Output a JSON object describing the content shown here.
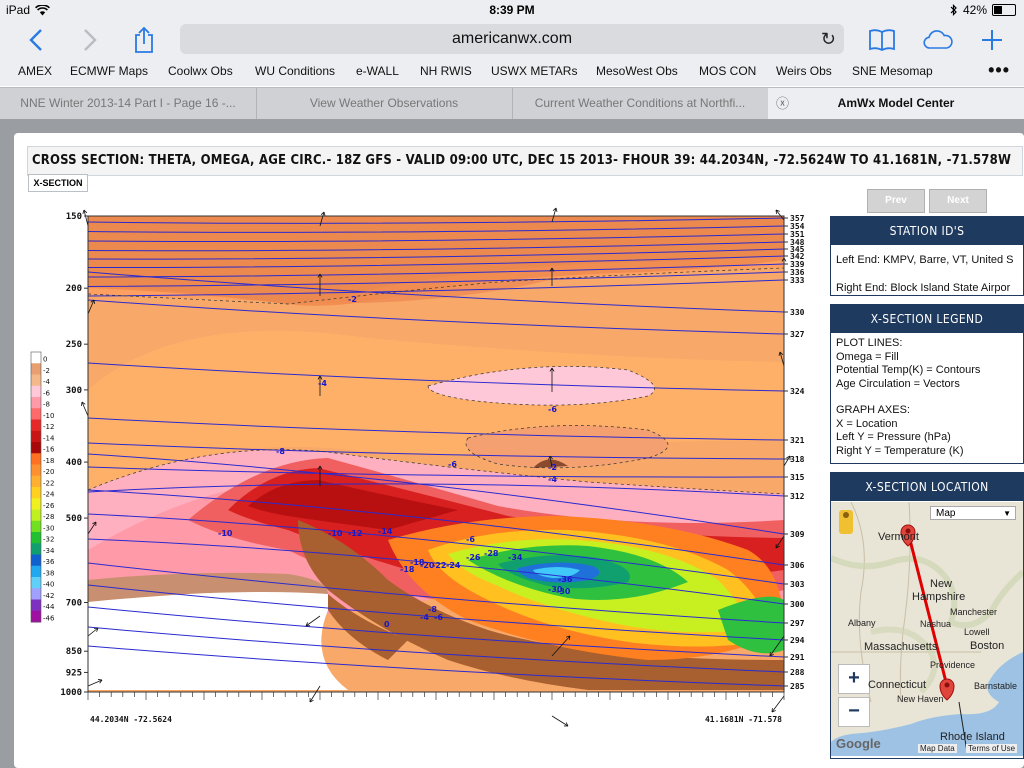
{
  "status": {
    "device": "iPad",
    "time": "8:39 PM",
    "battery": "42%",
    "battery_fraction": 0.42
  },
  "toolbar": {
    "url": "americanwx.com",
    "back": "back-chevron-icon",
    "forward": "forward-chevron-icon",
    "share": "share-icon",
    "bookmarks": "book-icon",
    "cloud": "cloud-icon",
    "add": "plus-icon",
    "reload": "reload-icon"
  },
  "bookmarks": [
    "AMEX",
    "ECMWF Maps",
    "Coolwx Obs",
    "WU Conditions",
    "e-WALL",
    "NH RWIS",
    "USWX METARs",
    "MesoWest Obs",
    "MOS CON",
    "Weirs Obs",
    "SNE Mesomap"
  ],
  "tabs": [
    {
      "label": "NNE Winter 2013-14 Part I - Page 16 -...",
      "active": false
    },
    {
      "label": "View Weather Observations",
      "active": false
    },
    {
      "label": "Current Weather Conditions at Northfi...",
      "active": false
    },
    {
      "label": "AmWx Model Center",
      "active": true
    }
  ],
  "page": {
    "title": "CROSS SECTION: THETA, OMEGA, AGE CIRC.- 18Z GFS - VALID 09:00 UTC, DEC 15 2013- FHOUR 39: 44.2034N, -72.5624W TO 41.1681N, -71.578W",
    "xsec_tab": "X-SECTION",
    "prev": "Prev",
    "next": "Next"
  },
  "station": {
    "header": "STATION ID'S",
    "left": "Left End: KMPV, Barre, VT, United S",
    "right": "Right End: Block Island State Airpor"
  },
  "legend": {
    "header": "X-SECTION LEGEND",
    "lines": [
      "PLOT LINES:",
      "Omega = Fill",
      "Potential Temp(K) = Contours",
      "Age Circulation = Vectors",
      "",
      "GRAPH AXES:",
      "X = Location",
      "Left Y = Pressure (hPa)",
      "Right Y = Temperature (K)"
    ]
  },
  "location": {
    "header": "X-SECTION LOCATION",
    "map_type": "Map",
    "zoom_in": "+",
    "zoom_out": "−",
    "labels": [
      "Vermont",
      "New Hampshire",
      "Manchester",
      "Nashua",
      "Lowell",
      "Albany",
      "Massachusetts",
      "Boston",
      "Providence",
      "Connecticut",
      "New Haven",
      "Barnstable",
      "Rhode Island"
    ],
    "footer": [
      "Map Data",
      "Terms of Use"
    ],
    "google": "Google"
  },
  "chart_data": {
    "type": "heatmap",
    "title": "CROSS SECTION: THETA, OMEGA, AGE CIRC.- 18Z GFS - VALID 09:00 UTC, DEC 15 2013- FHOUR 39: 44.2034N, -72.5624W TO 41.1681N, -71.578W",
    "left_axis_ticks": [
      "150",
      "200",
      "250",
      "300",
      "400",
      "500",
      "700",
      "850",
      "925",
      "1000"
    ],
    "right_axis_ticks": [
      "357",
      "354",
      "351",
      "348",
      "345",
      "342",
      "339",
      "336",
      "333",
      "330",
      "327",
      "324",
      "321",
      "318",
      "315",
      "312",
      "309",
      "306",
      "303",
      "300",
      "297",
      "294",
      "291",
      "288",
      "285"
    ],
    "x_start_label": "44.2034N -72.5624",
    "x_end_label": "41.1681N -71.578",
    "colorbar_labels": [
      "0",
      "-2",
      "-4",
      "-6",
      "-8",
      "-10",
      "-12",
      "-14",
      "-16",
      "-18",
      "-20",
      "-22",
      "-24",
      "-26",
      "-28",
      "-30",
      "-32",
      "-34",
      "-36",
      "-38",
      "-40",
      "-42",
      "-44",
      "-46"
    ],
    "colorbar_colors": [
      "#ffffff",
      "#e8a070",
      "#f5b888",
      "#ffc8d8",
      "#ff9aa8",
      "#ff6a6a",
      "#e82828",
      "#c81414",
      "#a80808",
      "#ff7020",
      "#ff9030",
      "#ffb030",
      "#ffd020",
      "#f0f020",
      "#c0f020",
      "#70e020",
      "#20c030",
      "#10a070",
      "#1060d0",
      "#20a8f0",
      "#60d0f8",
      "#a0a0ff",
      "#8030c0",
      "#a010a0"
    ],
    "contour_labels": [
      "-2",
      "-4",
      "-6",
      "-6",
      "-8",
      "-2",
      "-4",
      "-6",
      "-10",
      "-10",
      "-12",
      "-14",
      "-18",
      "-18",
      "-20",
      "-22",
      "-24",
      "-26",
      "-28",
      "-34",
      "-36",
      "-30",
      "-30",
      "-8",
      "-4",
      "-6",
      "0"
    ]
  }
}
